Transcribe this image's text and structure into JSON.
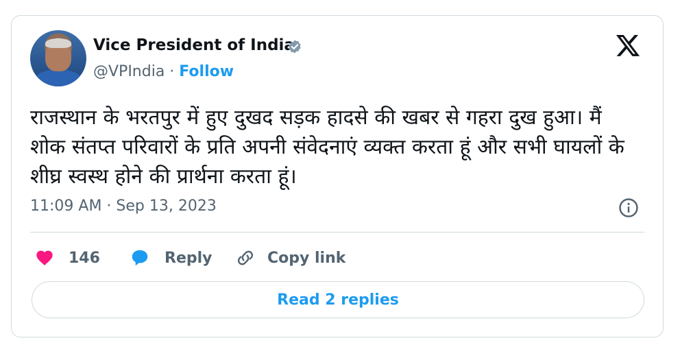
{
  "author": {
    "name": "Vice President of India",
    "handle": "@VPIndia",
    "separator": " · ",
    "follow_label": "Follow"
  },
  "tweet": {
    "text": "राजस्थान के भरतपुर में हुए दुखद सड़क हादसे की खबर से गहरा दुख हुआ। मैं शोक संतप्त परिवारों के प्रति अपनी संवेदनाएं व्यक्त करता हूं और सभी घायलों के शीघ्र स्वस्थ होने की प्रार्थना करता हूं।",
    "timestamp": "11:09 AM · Sep 13, 2023"
  },
  "actions": {
    "like_count": "146",
    "reply_label": "Reply",
    "copy_label": "Copy link"
  },
  "replies_button": "Read 2 replies",
  "colors": {
    "accent": "#1d9bf0",
    "like": "#f91880",
    "text": "#0f1419",
    "muted": "#536471",
    "border": "#cfd9de"
  },
  "icons": [
    "verified-badge-icon",
    "x-logo-icon",
    "info-icon",
    "heart-icon",
    "reply-bubble-icon",
    "link-icon"
  ]
}
